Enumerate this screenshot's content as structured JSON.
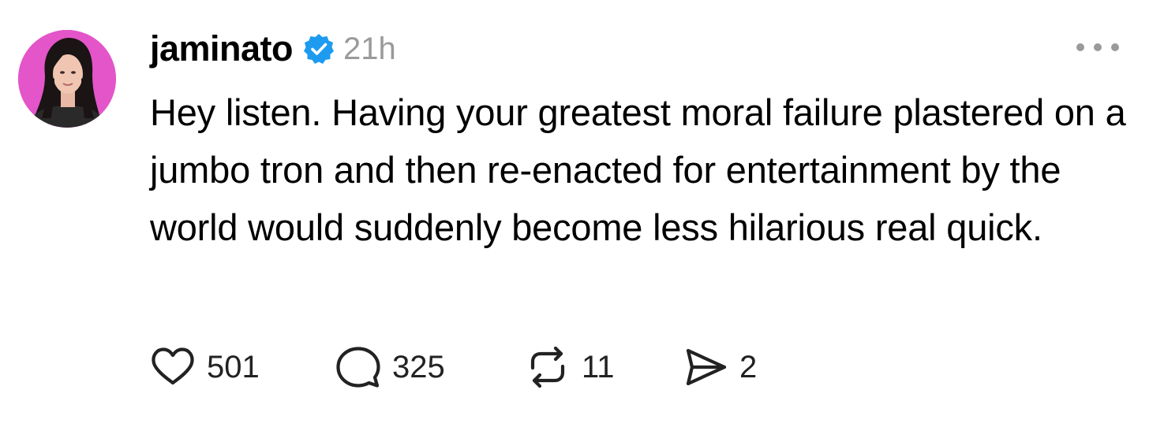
{
  "post": {
    "author": {
      "username": "jaminato",
      "verified": true,
      "avatar_bg": "#e455c9"
    },
    "timestamp": "21h",
    "body": "Hey listen. Having your greatest moral failure plastered on a jumbo tron and then re-enacted for entertainment by the world would suddenly become less hilarious real quick.",
    "stats": {
      "likes": "501",
      "replies": "325",
      "reposts": "11",
      "shares": "2"
    },
    "icons": {
      "like": "heart-icon",
      "reply": "speech-bubble-icon",
      "repost": "repost-arrows-icon",
      "share": "send-icon",
      "more": "more-options-icon",
      "verified": "verified-badge-icon"
    },
    "colors": {
      "verified_blue": "#1d9bf0",
      "muted_gray": "#9a9a9a"
    }
  }
}
